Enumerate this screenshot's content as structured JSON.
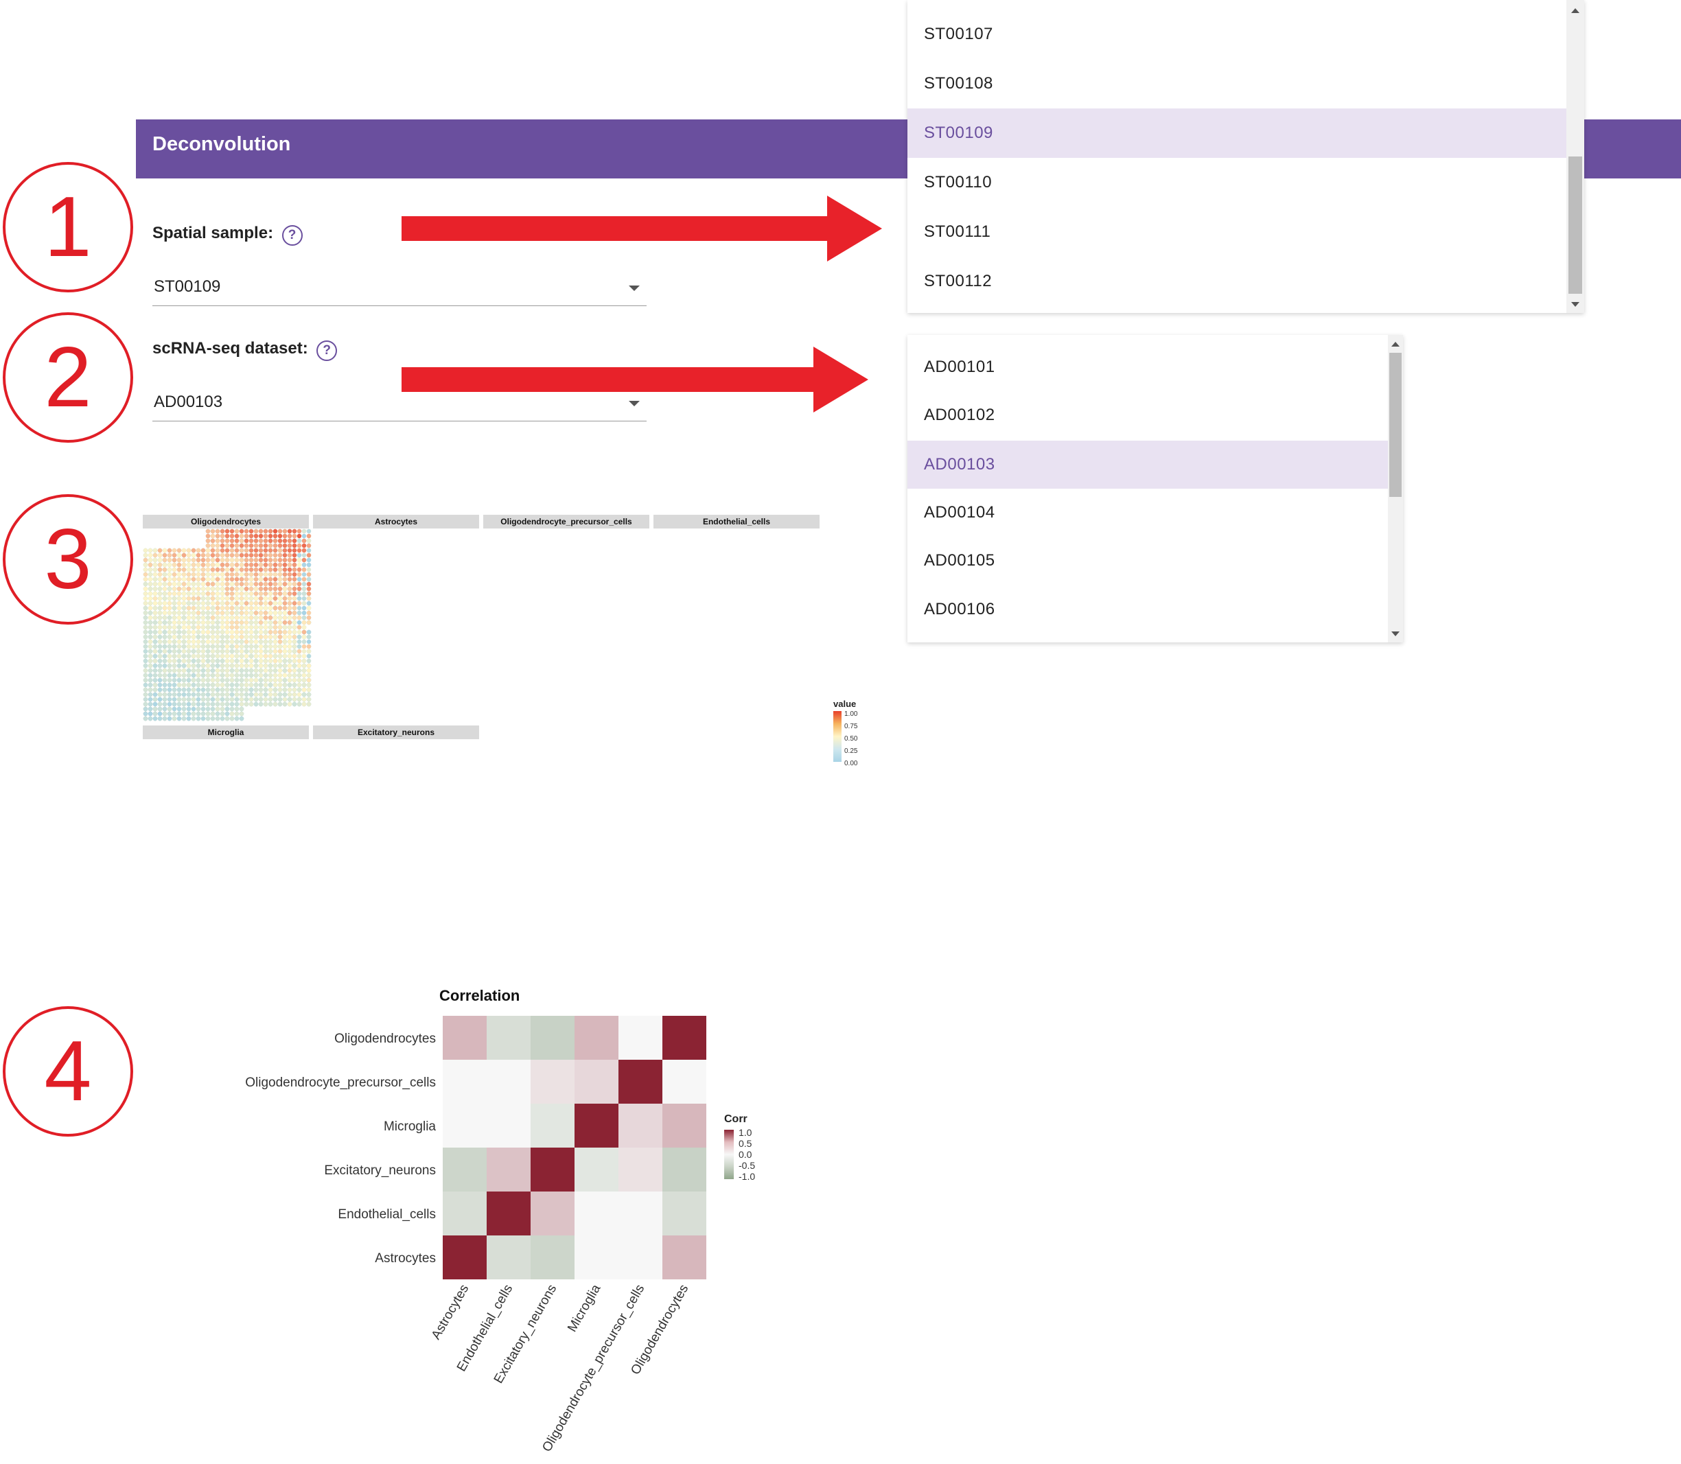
{
  "header": {
    "title": "Deconvolution"
  },
  "steps": [
    "1",
    "2",
    "3",
    "4"
  ],
  "spatial": {
    "label": "Spatial sample:",
    "help": "?",
    "value": "ST00109"
  },
  "scrna": {
    "label": "scRNA-seq dataset:",
    "help": "?",
    "value": "AD00103"
  },
  "spatial_dropdown": {
    "options": [
      "ST00107",
      "ST00108",
      "ST00109",
      "ST00110",
      "ST00111",
      "ST00112"
    ],
    "selected": "ST00109"
  },
  "scrna_dropdown": {
    "options": [
      "AD00101",
      "AD00102",
      "AD00103",
      "AD00104",
      "AD00105",
      "AD00106"
    ],
    "selected": "AD00103"
  },
  "spatial_maps": {
    "panels": [
      "Oligodendrocytes",
      "Astrocytes",
      "Oligodendrocyte_precursor_cells",
      "Endothelial_cells",
      "Microglia",
      "Excitatory_neurons"
    ],
    "legend_title": "value",
    "legend_ticks": [
      "1.00",
      "0.75",
      "0.50",
      "0.25",
      "0.00"
    ],
    "colors": {
      "low": "#a8d4e6",
      "mid": "#fff5c8",
      "high": "#e8402a"
    }
  },
  "chart_data": {
    "type": "heatmap",
    "title": "Correlation",
    "rows": [
      "Oligodendrocytes",
      "Oligodendrocyte_precursor_cells",
      "Microglia",
      "Excitatory_neurons",
      "Endothelial_cells",
      "Astrocytes"
    ],
    "cols": [
      "Astrocytes",
      "Endothelial_cells",
      "Excitatory_neurons",
      "Microglia",
      "Oligodendrocyte_precursor_cells",
      "Oligodendrocytes"
    ],
    "values": [
      [
        0.3,
        -0.3,
        -0.45,
        0.3,
        0.0,
        1.0
      ],
      [
        0.0,
        0.0,
        0.1,
        0.15,
        1.0,
        0.0
      ],
      [
        0.0,
        0.0,
        -0.2,
        1.0,
        0.15,
        0.3
      ],
      [
        -0.4,
        0.25,
        1.0,
        -0.2,
        0.1,
        -0.45
      ],
      [
        -0.3,
        1.0,
        0.25,
        0.0,
        0.0,
        -0.3
      ],
      [
        1.0,
        -0.3,
        -0.4,
        0.0,
        0.0,
        0.3
      ]
    ],
    "legend_title": "Corr",
    "legend_ticks": [
      "1.0",
      "0.5",
      "0.0",
      "-0.5",
      "-1.0"
    ],
    "colors": {
      "pos": "#8b2333",
      "neg": "#8fa58a",
      "zero": "#f7f7f7"
    }
  }
}
